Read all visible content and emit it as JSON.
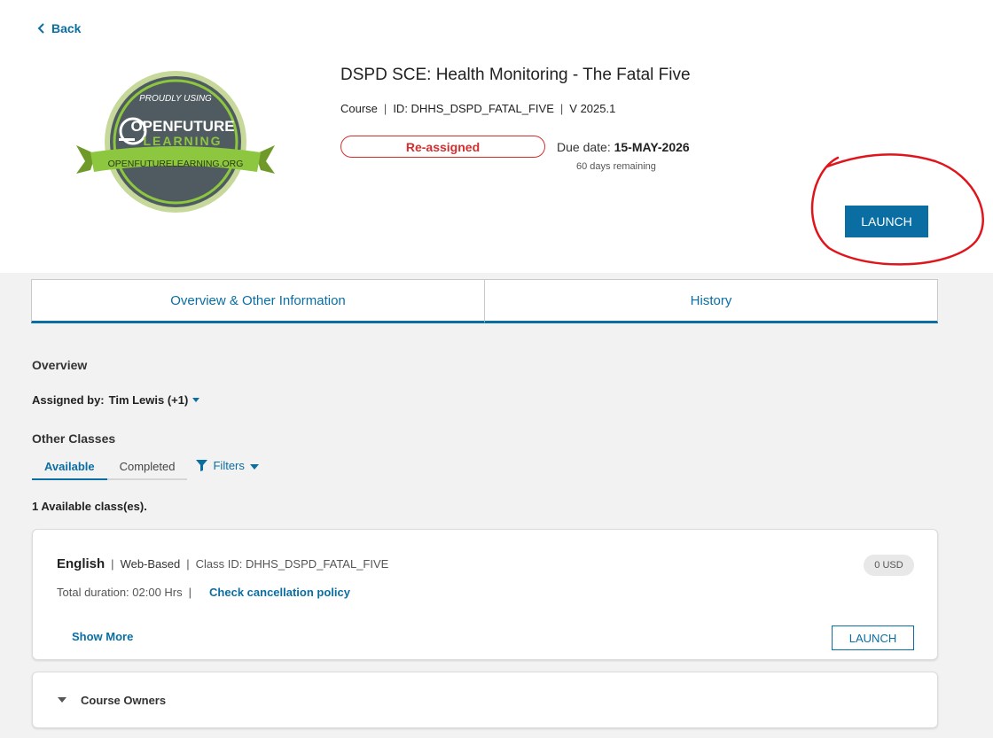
{
  "nav": {
    "back_label": "Back"
  },
  "logo": {
    "top_text": "PROUDLY USING",
    "brand_line1": "OPENFUTURE",
    "brand_line2": "LEARNING",
    "ribbon_text": "OPENFUTURELEARNING.ORG"
  },
  "course": {
    "title": "DSPD SCE: Health Monitoring - The Fatal Five",
    "type": "Course",
    "id_text": "ID: DHHS_DSPD_FATAL_FIVE",
    "version": "V 2025.1",
    "status": "Re-assigned",
    "due_label": "Due date:",
    "due_date": "15-MAY-2026",
    "remaining": "60 days remaining",
    "launch_label": "LAUNCH"
  },
  "tabs": [
    {
      "label": "Overview & Other Information"
    },
    {
      "label": "History"
    }
  ],
  "overview": {
    "heading": "Overview",
    "assigned_label": "Assigned by:",
    "assigned_value": "Tim Lewis (+1)"
  },
  "other_classes": {
    "heading": "Other Classes",
    "subtabs": [
      {
        "label": "Available"
      },
      {
        "label": "Completed"
      }
    ],
    "filters_label": "Filters",
    "count_text": "1 Available class(es)."
  },
  "class_card": {
    "language": "English",
    "delivery": "Web-Based",
    "class_id": "Class ID: DHHS_DSPD_FATAL_FIVE",
    "price": "0 USD",
    "duration": "Total duration: 02:00 Hrs",
    "policy_link": "Check cancellation policy",
    "show_more": "Show More",
    "launch_label": "LAUNCH"
  },
  "owners": {
    "label": "Course Owners"
  },
  "colors": {
    "accent": "#0b6ea3",
    "status_red": "#d32f2f",
    "annotation": "#e0151b",
    "logo_green": "#8dc63f"
  },
  "separator": "|"
}
